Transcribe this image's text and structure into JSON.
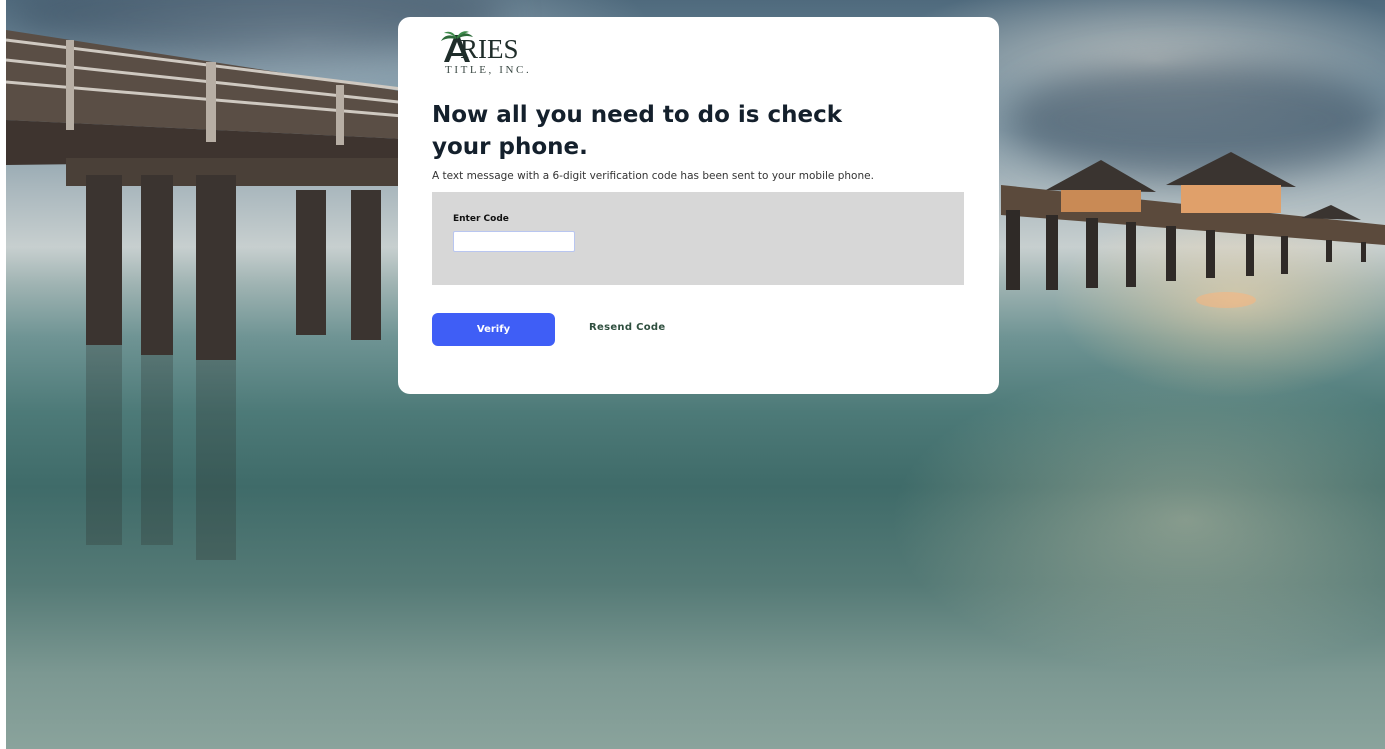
{
  "brand": {
    "name": "RIES",
    "subtitle": "TITLE, INC.",
    "logo_icon": "palm-tree-a-icon",
    "logo_color": "#2e6b3a"
  },
  "verification": {
    "heading": "Now all you need to do is check your phone.",
    "message": "A text message with a 6-digit verification code has been sent to your mobile phone.",
    "code_label": "Enter Code",
    "code_value": "",
    "code_placeholder": ""
  },
  "actions": {
    "verify_label": "Verify",
    "resend_label": "Resend Code"
  },
  "colors": {
    "primary_button": "#3f5ef6",
    "resend_link": "#2f4f3f",
    "panel_background": "#d7d7d7",
    "card_background": "#ffffff"
  }
}
